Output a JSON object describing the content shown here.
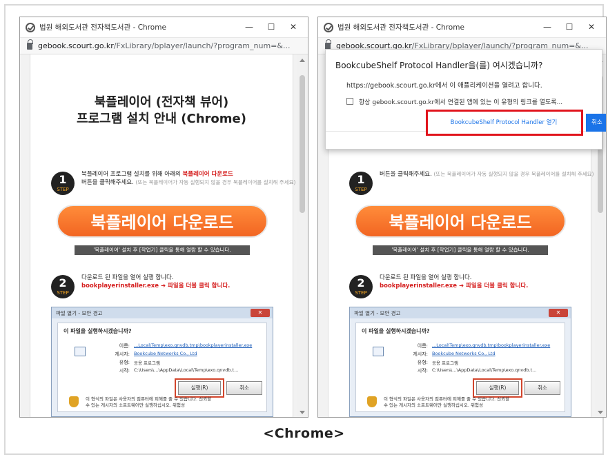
{
  "shots": [
    {
      "window_title": "법원 해외도서관 전자책도서관 - Chrome",
      "url_host": "gebook.scourt.go.kr",
      "url_path": "/FxLibrary/bplayer/launch/?program_num=&...",
      "window_buttons": {
        "minimize": "—",
        "maximize": "☐",
        "close": "✕"
      },
      "page": {
        "title_line1": "북플레이어 (전자책 뷰어)",
        "title_line2": "프로그램 설치 안내 (Chrome)",
        "step_word": "STEP",
        "step1_num": "1",
        "step1_text_a": "북플레이어 프로그램 설치를 위해 아래의 ",
        "step1_text_red": "북플레이어 다운로드",
        "step1_text_b": "버튼을 클릭해주세요.",
        "step1_text_grey": "(또는 북플레이어가 자동 실행되지 않을 경우 북플레이어를 설치해 주세요)",
        "download_button": "북플레이어 다운로드",
        "download_note": "'북플레이어' 설치 후 [작업기] 클릭을 통해 열람 할 수 있습니다.",
        "step2_num": "2",
        "step2_text_a": "다운로드 된 파일을 열어 실행 합니다.",
        "step2_text_red": "bookplayerinstaller.exe ➜ 파일을 더블 클릭 합니다."
      },
      "dialog": {
        "title": "파일 열기 - 보안 경고",
        "close": "✕",
        "question": "이 파일을 실행하시겠습니까?",
        "name_label": "이름:",
        "name_value": "...Local\\Temp\\exo.qnvdb.tmp\\bookplayerinstaller.exe",
        "publisher_label": "게시자:",
        "publisher_value": "Bookcube Networks Co., Ltd",
        "type_label": "유형:",
        "type_value": "응용 프로그램",
        "from_label": "시작:",
        "from_value": "C:\\Users\\...\\AppData\\Local\\Temp\\exo.qnvdb.t...",
        "run_button": "실행(R)",
        "cancel_button": "취소",
        "warning": "이 형식의 파일은 사용자의 컴퓨터에 피해를 줄 수 있습니다. 신뢰할\n수 있는 게시자의 소프트웨어만 실행하십시오. 위험성"
      }
    },
    {
      "window_title": "법원 해외도서관 전자책도서관 - Chrome",
      "url_host": "gebook.scourt.go.kr",
      "url_path": "/FxLibrary/bplayer/launch/?program_num=&...",
      "window_buttons": {
        "minimize": "—",
        "maximize": "☐",
        "close": "✕"
      },
      "page": {
        "title_line1": "",
        "title_line2": "",
        "step_word": "STEP",
        "step1_num": "1",
        "step1_text_a": "",
        "step1_text_red": "",
        "step1_text_b": "버튼을 클릭해주세요.",
        "step1_text_grey": "(또는 북플레이어가 자동 실행되지 않을 경우 북플레이어를 설치해 주세요)",
        "download_button": "북플레이어 다운로드",
        "download_note": "'북플레이어' 설치 후 [작업기] 클릭을 통해 열람 할 수 있습니다.",
        "step2_num": "2",
        "step2_text_a": "다운로드 된 파일을 열어 실행 합니다.",
        "step2_text_red": "bookplayerinstaller.exe ➜ 파일을 더블 클릭 합니다."
      },
      "dialog": {
        "title": "파일 열기 - 보안 경고",
        "close": "✕",
        "question": "이 파일을 실행하시겠습니까?",
        "name_label": "이름:",
        "name_value": "...Local\\Temp\\exo.qnvdb.tmp\\bookplayerinstaller.exe",
        "publisher_label": "게시자:",
        "publisher_value": "Bookcube Networks Co., Ltd",
        "type_label": "유형:",
        "type_value": "응용 프로그램",
        "from_label": "시작:",
        "from_value": "C:\\Users\\...\\AppData\\Local\\Temp\\exo.qnvdb.t...",
        "run_button": "실행(R)",
        "cancel_button": "취소",
        "warning": "이 형식의 파일은 사용자의 컴퓨터에 피해를 줄 수 있습니다. 신뢰할\n수 있는 게시자의 소프트웨어만 실행하십시오. 위험성"
      },
      "protocol_popup": {
        "title": "BookcubeShelf Protocol Handler을(를) 여시겠습니까?",
        "description": "https://gebook.scourt.go.kr에서 이 애플리케이션을 열려고 합니다.",
        "checkbox_label": "항상 gebook.scourt.go.kr에서 연결된 앱에 있는 이 유형의 링크를 열도록...",
        "open_button": "BookcubeShelf Protocol Handler 열기",
        "cancel_button": "취소"
      }
    }
  ],
  "caption": "<Chrome>",
  "colors": {
    "accent_orange": "#f26522",
    "highlight_red": "#e1141c",
    "chrome_blue": "#1a73e8"
  }
}
